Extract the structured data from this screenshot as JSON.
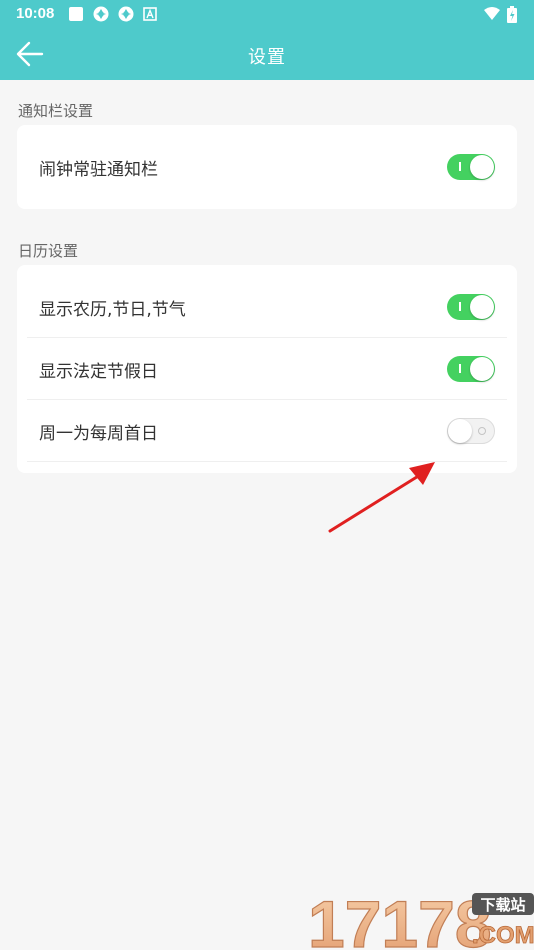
{
  "status_bar": {
    "time": "10:08",
    "icons": [
      "square-icon",
      "pinwheel-icon",
      "pinwheel-icon",
      "app-a-icon",
      "wifi-icon",
      "battery-charging-icon"
    ]
  },
  "app_bar": {
    "title": "设置",
    "back_icon": "arrow-left-icon"
  },
  "sections": [
    {
      "label": "通知栏设置",
      "items": [
        {
          "label": "闹钟常驻通知栏",
          "on": true
        }
      ]
    },
    {
      "label": "日历设置",
      "items": [
        {
          "label": "显示农历,节日,节气",
          "on": true
        },
        {
          "label": "显示法定节假日",
          "on": true
        },
        {
          "label": "周一为每周首日",
          "on": false
        }
      ]
    }
  ],
  "annotation": {
    "arrow_color": "#e02020"
  },
  "watermark": {
    "number": "17178",
    "tag": "下载站",
    "domain": ".COM"
  },
  "colors": {
    "accent": "#4ecacb",
    "toggle_on": "#44d160"
  }
}
